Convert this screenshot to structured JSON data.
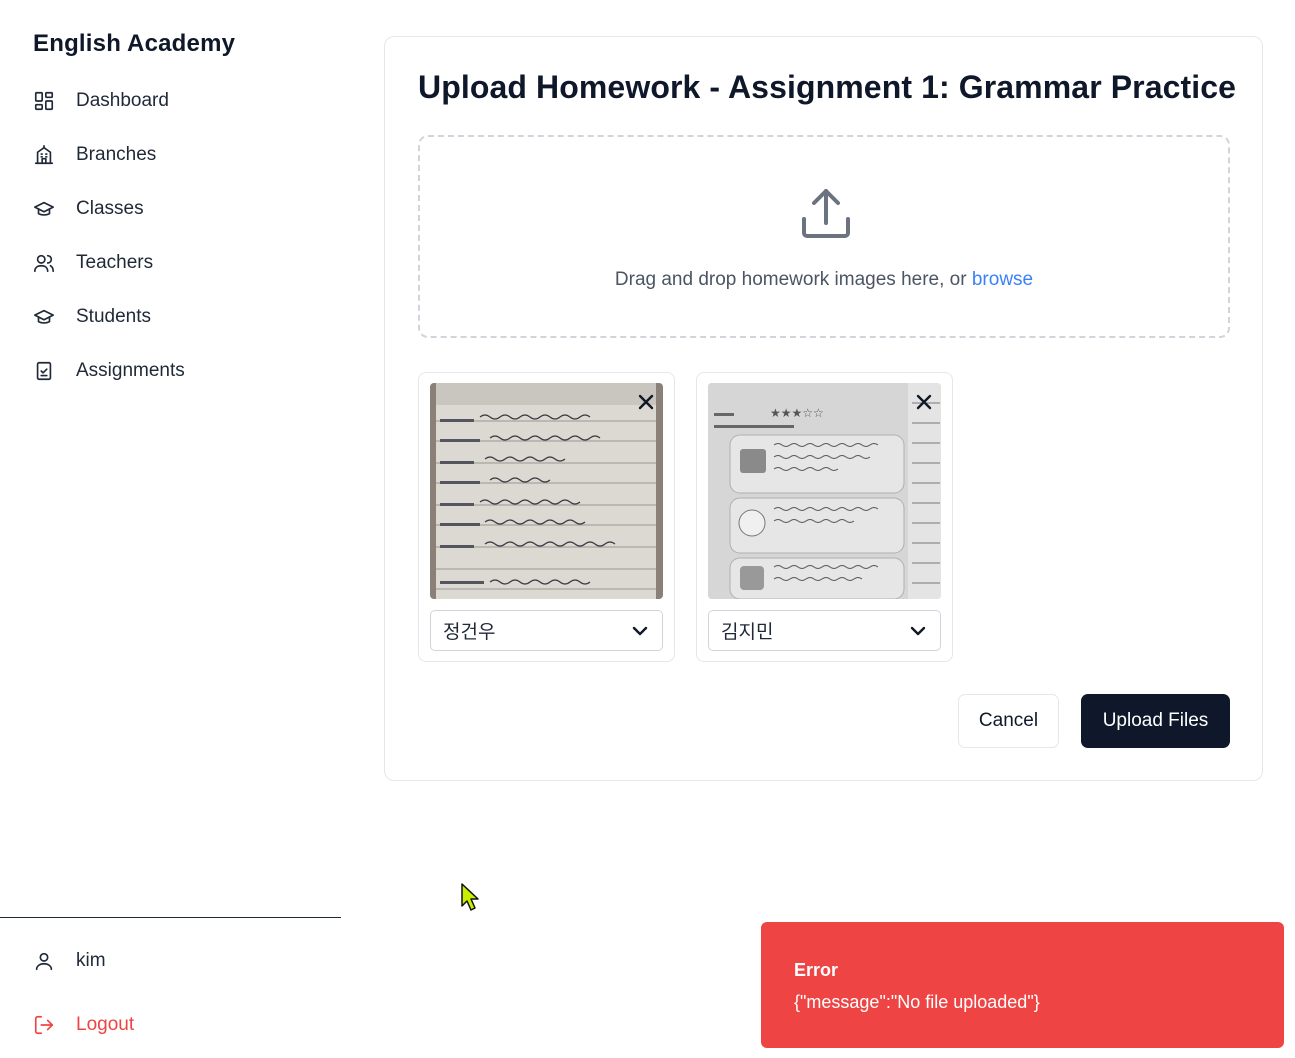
{
  "sidebar": {
    "brand": "English Academy",
    "nav": [
      {
        "label": "Dashboard",
        "icon": "dashboard-icon"
      },
      {
        "label": "Branches",
        "icon": "building-icon"
      },
      {
        "label": "Classes",
        "icon": "graduation-cap-icon"
      },
      {
        "label": "Teachers",
        "icon": "users-icon"
      },
      {
        "label": "Students",
        "icon": "graduation-cap-icon"
      },
      {
        "label": "Assignments",
        "icon": "clipboard-check-icon"
      }
    ],
    "user": {
      "name": "kim",
      "icon": "user-icon"
    },
    "logout": {
      "label": "Logout",
      "icon": "logout-icon",
      "color": "#ef4444"
    }
  },
  "main": {
    "title": "Upload Homework - Assignment 1: Grammar Practice",
    "dropzone": {
      "text": "Drag and drop homework images here, or ",
      "link": "browse",
      "icon": "upload-icon"
    },
    "uploads": [
      {
        "student": "정건우",
        "remove_icon": "close-icon"
      },
      {
        "student": "김지민",
        "remove_icon": "close-icon"
      }
    ],
    "buttons": {
      "cancel": "Cancel",
      "upload": "Upload Files"
    }
  },
  "toast": {
    "title": "Error",
    "message": "{\"message\":\"No file uploaded\"}",
    "color": "#ef4444"
  },
  "colors": {
    "primary": "#0f172a",
    "link": "#3b82f6",
    "danger": "#ef4444"
  }
}
